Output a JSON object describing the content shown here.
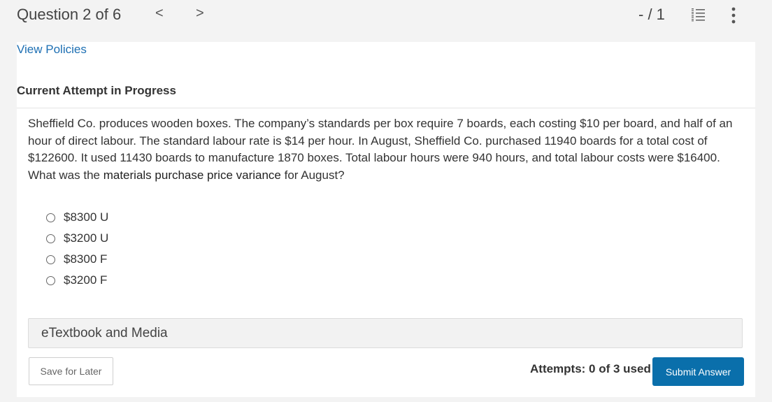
{
  "header": {
    "question_title": "Question 2 of 6",
    "prev_glyph": "<",
    "next_glyph": ">",
    "score": "- / 1",
    "list_icon": "numbered-list-icon",
    "more_icon": "vertical-ellipsis-icon"
  },
  "policies": {
    "link_label": "View Policies"
  },
  "attempt": {
    "heading": "Current Attempt in Progress"
  },
  "question": {
    "text_before": "Sheffield Co. produces wooden boxes. The company’s standards per box require 7 boards, each costing $10 per board, and half of an hour of direct labour. The standard labour rate is $14 per hour. In August, Sheffield Co. purchased 11940 boards for a total cost of $122600. It used 11430 boards to manufacture 1870 boxes. Total labour hours were 940 hours, and total labour costs were $16400. What was the ",
    "text_bold": "materials purchase price variance",
    "text_after": " for August?"
  },
  "options": [
    {
      "label": "$8300 U"
    },
    {
      "label": "$3200 U"
    },
    {
      "label": "$8300 F"
    },
    {
      "label": "$3200 F"
    }
  ],
  "etextbook": {
    "label": "eTextbook and Media"
  },
  "footer": {
    "save_label": "Save for Later",
    "attempts_text": "Attempts: 0 of 3 used",
    "submit_label": "Submit Answer"
  },
  "colors": {
    "link": "#1d6fb3",
    "submit_bg": "#0a6fab",
    "page_bg": "#f3f3f3",
    "panel_bg": "#ffffff"
  }
}
